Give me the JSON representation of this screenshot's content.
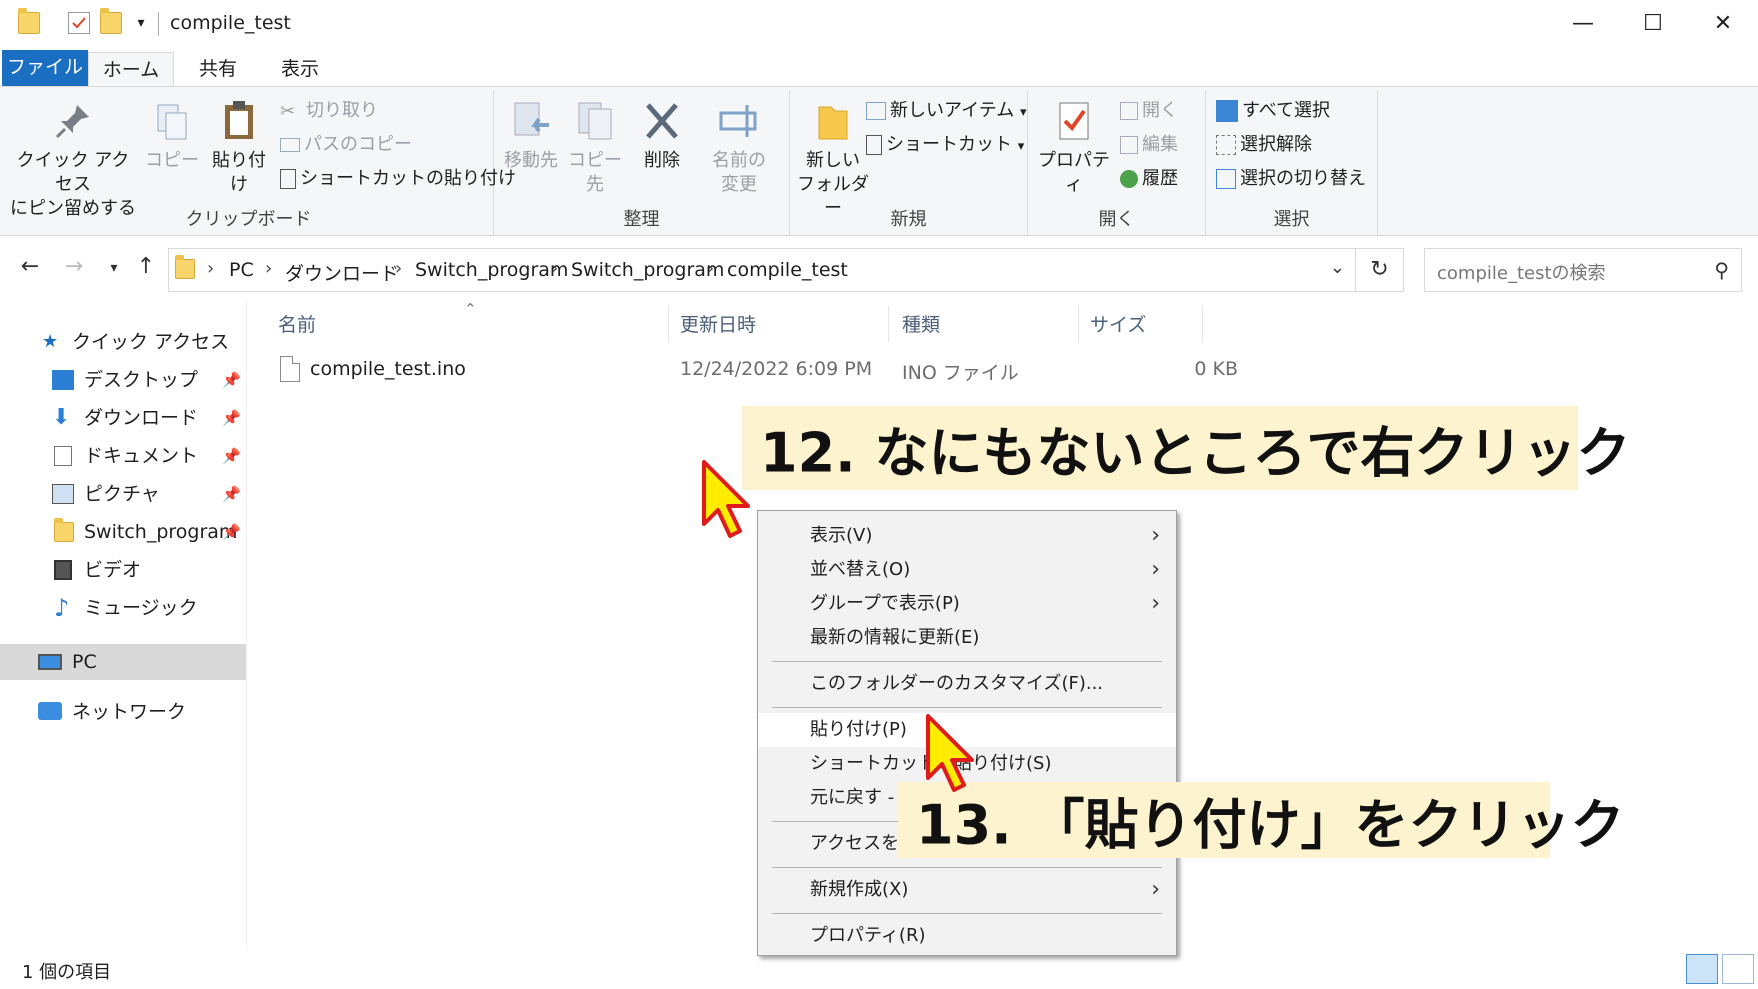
{
  "window": {
    "title": "compile_test",
    "minimize": "—",
    "maximize": "☐",
    "close": "✕"
  },
  "ribbon_tabs": {
    "file": "ファイル",
    "home": "ホーム",
    "share": "共有",
    "view": "表示",
    "help": "?",
    "collapse": "︿"
  },
  "ribbon": {
    "clipboard": {
      "label": "クリップボード",
      "pin_quick_access": "クイック アクセス\nにピン留めする",
      "copy": "コピー",
      "paste": "貼り付け",
      "cut": "切り取り",
      "copy_path": "パスのコピー",
      "paste_shortcut": "ショートカットの貼り付け"
    },
    "organize": {
      "label": "整理",
      "move_to": "移動先",
      "copy_to": "コピー先",
      "delete": "削除",
      "rename": "名前の\n変更"
    },
    "new": {
      "label": "新規",
      "new_folder": "新しい\nフォルダー",
      "new_item": "新しいアイテム",
      "easy_access": "ショートカット"
    },
    "open": {
      "label": "開く",
      "properties": "プロパティ",
      "open": "開く",
      "edit": "編集",
      "history": "履歴"
    },
    "select": {
      "label": "選択",
      "select_all": "すべて選択",
      "select_none": "選択解除",
      "invert": "選択の切り替え"
    }
  },
  "address": {
    "crumbs": [
      "PC",
      "ダウンロード",
      "Switch_program",
      "Switch_program",
      "compile_test"
    ],
    "search_placeholder": "compile_testの検索"
  },
  "nav_pane": {
    "quick_access": "クイック アクセス",
    "items": [
      "デスクトップ",
      "ダウンロード",
      "ドキュメント",
      "ピクチャ",
      "Switch_program",
      "ビデオ",
      "ミュージック"
    ],
    "pc": "PC",
    "network": "ネットワーク"
  },
  "columns": {
    "name": "名前",
    "modified": "更新日時",
    "type": "種類",
    "size": "サイズ"
  },
  "files": [
    {
      "name": "compile_test.ino",
      "modified": "12/24/2022 6:09 PM",
      "type": "INO ファイル",
      "size": "0 KB"
    }
  ],
  "status": {
    "count": "1 個の項目"
  },
  "context_menu": {
    "view": "表示(V)",
    "sort_by": "並べ替え(O)",
    "group_by": "グループで表示(P)",
    "refresh": "最新の情報に更新(E)",
    "customize": "このフォルダーのカスタマイズ(F)...",
    "paste": "貼り付け(P)",
    "paste_shortcut": "ショートカットの貼り付け(S)",
    "undo": "元に戻す - 名前の変更",
    "give_access": "アクセスを許可する",
    "new": "新規作成(X)",
    "properties": "プロパティ(R)"
  },
  "annotations": {
    "step12": "12.  なにもないところで右クリック",
    "step13": "13.  「貼り付け」をクリック"
  },
  "colors": {
    "accent": "#1a6fc3",
    "callout_bg": "#fdf3ce",
    "cursor_fill": "#ffec00",
    "cursor_outline": "#e01b1b"
  }
}
